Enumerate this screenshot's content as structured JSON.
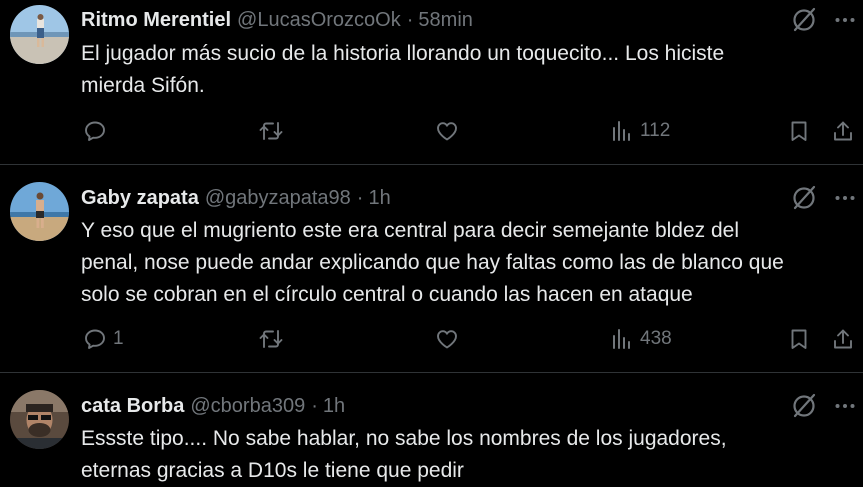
{
  "tweets": [
    {
      "name": "Ritmo Merentiel",
      "handle": "@LucasOrozcoOk",
      "separator": "·",
      "time": "58min",
      "lines": [
        "El jugador más sucio de la historia llorando un toquecito... Los hiciste",
        "mierda Sifón."
      ],
      "replies": "",
      "views": "112"
    },
    {
      "name": "Gaby zapata",
      "handle": "@gabyzapata98",
      "separator": "·",
      "time": "1h",
      "lines": [
        "Y eso que el mugriento este era central para decir semejante bldez del",
        "penal, nose puede andar explicando que hay faltas como las de blanco que",
        "solo se cobran en el círculo central o cuando las hacen en ataque"
      ],
      "replies": "1",
      "views": "438"
    },
    {
      "name": "cata Borba",
      "handle": "@cborba309",
      "separator": "·",
      "time": "1h",
      "lines": [
        "Essste tipo.... No sabe hablar, no sabe los nombres de los jugadores,",
        "eternas gracias a D10s le tiene que pedir"
      ]
    }
  ],
  "icons": {
    "reply": "reply-icon",
    "retweet": "retweet-icon",
    "like": "like-icon",
    "views": "views-icon",
    "bookmark": "bookmark-icon",
    "share": "share-icon",
    "grok": "grok-icon",
    "more": "more-icon"
  },
  "colors": {
    "background": "#000000",
    "text": "#e7e9ea",
    "secondary": "#71767b",
    "divider": "#2f3336"
  }
}
